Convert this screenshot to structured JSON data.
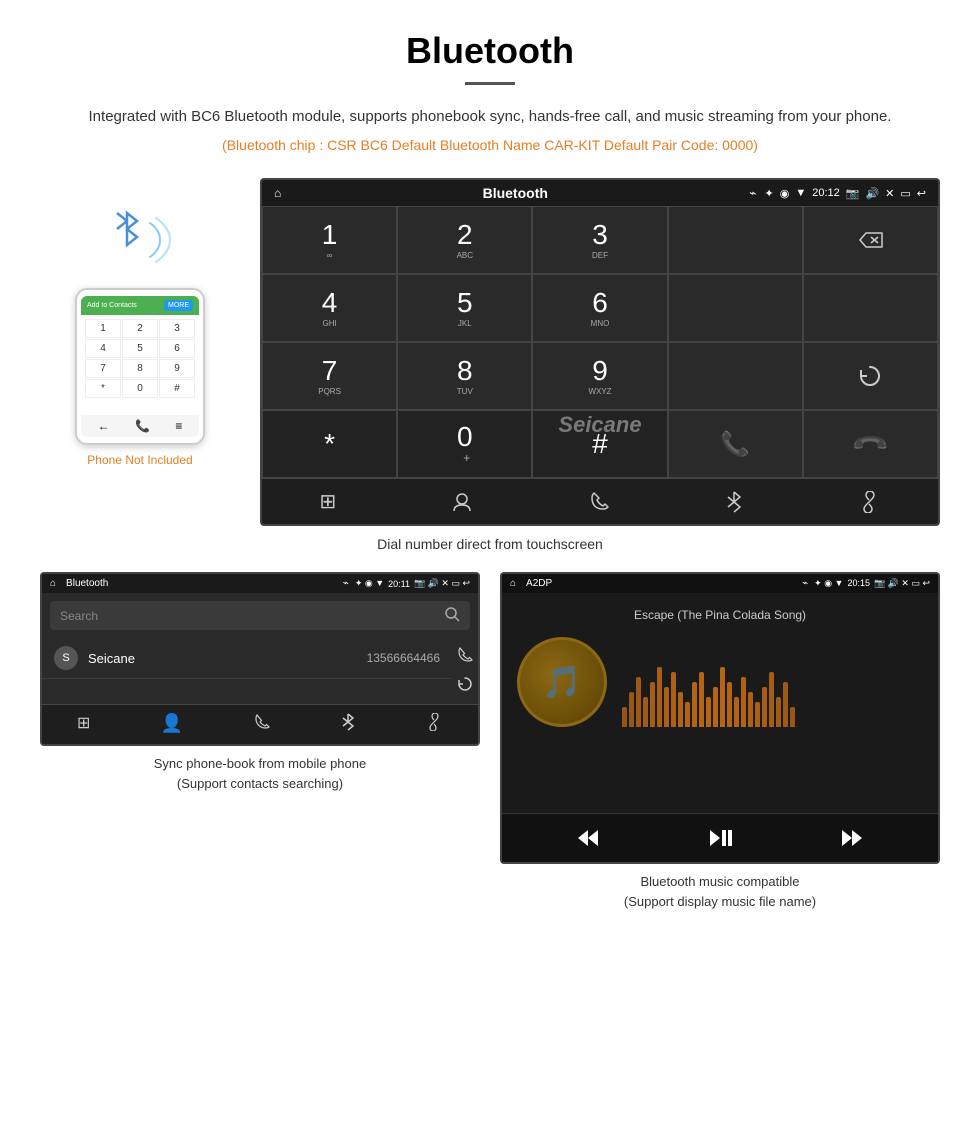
{
  "page": {
    "title": "Bluetooth",
    "divider": true,
    "description": "Integrated with BC6 Bluetooth module, supports phonebook sync, hands-free call, and music streaming from your phone.",
    "spec_text": "(Bluetooth chip : CSR BC6    Default Bluetooth Name CAR-KIT    Default Pair Code: 0000)",
    "watermark": "Seicane"
  },
  "dial_screen": {
    "statusbar": {
      "home_icon": "⌂",
      "title": "Bluetooth",
      "usb_icon": "⌁",
      "bt_icon": "✦",
      "location_icon": "◉",
      "signal_icon": "▼",
      "time": "20:12",
      "camera_icon": "📷",
      "volume_icon": "🔊",
      "close_icon": "✕",
      "window_icon": "⬜",
      "back_icon": "↩"
    },
    "keys": [
      {
        "num": "1",
        "sub": "∞",
        "col": 1
      },
      {
        "num": "2",
        "sub": "ABC",
        "col": 2
      },
      {
        "num": "3",
        "sub": "DEF",
        "col": 3
      },
      {
        "num": "4",
        "sub": "GHI",
        "col": 1
      },
      {
        "num": "5",
        "sub": "JKL",
        "col": 2
      },
      {
        "num": "6",
        "sub": "MNO",
        "col": 3
      },
      {
        "num": "7",
        "sub": "PQRS",
        "col": 1
      },
      {
        "num": "8",
        "sub": "TUV",
        "col": 2
      },
      {
        "num": "9",
        "sub": "WXYZ",
        "col": 3
      },
      {
        "num": "*",
        "sub": "",
        "col": 1
      },
      {
        "num": "0",
        "sub": "+",
        "col": 2
      },
      {
        "num": "#",
        "sub": "",
        "col": 3
      }
    ],
    "caption": "Dial number direct from touchscreen",
    "nav_icons": [
      "⊞",
      "👤",
      "📞",
      "✦",
      "🔗"
    ]
  },
  "phone_side": {
    "phone_not_included": "Phone Not Included",
    "smartphone": {
      "header_left": "Add to Contacts",
      "header_right": "MORE",
      "subheader": "",
      "keys": [
        "1",
        "2",
        "3",
        "4",
        "5",
        "6",
        "7",
        "8",
        "9",
        "*",
        "0",
        "#"
      ]
    }
  },
  "phonebook_screen": {
    "statusbar": {
      "home": "⌂",
      "title": "Bluetooth",
      "usb": "⌁",
      "time": "20:11",
      "icons": "✦ ◉ ▼"
    },
    "search_placeholder": "Search",
    "contacts": [
      {
        "letter": "S",
        "name": "Seicane",
        "number": "13566664466"
      }
    ],
    "caption": "Sync phone-book from mobile phone\n(Support contacts searching)",
    "nav_icons": [
      "⊞",
      "👤",
      "📞",
      "✦",
      "🔗"
    ]
  },
  "music_screen": {
    "statusbar": {
      "home": "⌂",
      "title": "A2DP",
      "time": "20:15",
      "icons": "✦ ◉ ▼"
    },
    "song_title": "Escape (The Pina Colada Song)",
    "album_art_icon": "♪",
    "eq_bars": [
      20,
      35,
      50,
      30,
      45,
      60,
      40,
      55,
      35,
      25,
      45,
      55,
      30,
      40,
      60,
      45,
      30,
      50,
      35,
      25,
      40,
      55,
      30,
      45,
      20
    ],
    "controls": {
      "rewind": "⏮",
      "play_pause": "⏯",
      "forward": "⏭"
    },
    "caption": "Bluetooth music compatible\n(Support display music file name)"
  }
}
